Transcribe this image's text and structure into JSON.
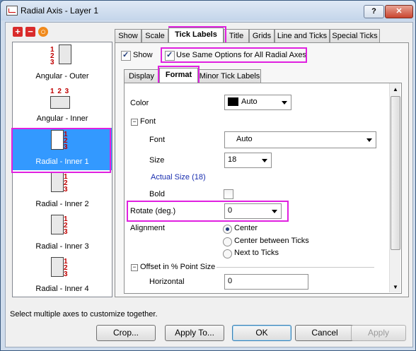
{
  "window": {
    "title": "Radial Axis - Layer 1",
    "help_label": "?",
    "close_label": "✕"
  },
  "toolbar": {
    "add": "+",
    "remove": "−",
    "reset": "○"
  },
  "axes_list": [
    {
      "label": "Angular - Outer",
      "numbers": "1\n2\n3"
    },
    {
      "label": "Angular - Inner",
      "numbers": "1 2 3"
    },
    {
      "label": "Radial - Inner 1",
      "numbers": "1\n2\n3",
      "selected": true
    },
    {
      "label": "Radial - Inner 2",
      "numbers": "1\n2\n3"
    },
    {
      "label": "Radial - Inner 3",
      "numbers": "1\n2\n3"
    },
    {
      "label": "Radial - Inner 4",
      "numbers": "1\n2\n3"
    }
  ],
  "tabs": [
    "Show",
    "Scale",
    "Tick Labels",
    "Title",
    "Grids",
    "Line and Ticks",
    "Special Ticks"
  ],
  "active_tab": "Tick Labels",
  "show_label": "Show",
  "use_same_label": "Use Same Options for All Radial Axes",
  "subtabs": [
    "Display",
    "Format",
    "Minor Tick Labels"
  ],
  "active_subtab": "Format",
  "format": {
    "color_label": "Color",
    "color_value": "Auto",
    "font_group": "Font",
    "font_label": "Font",
    "font_value": "Auto",
    "size_label": "Size",
    "size_value": "18",
    "actual_size": "Actual Size (18)",
    "bold_label": "Bold",
    "rotate_label": "Rotate (deg.)",
    "rotate_value": "0",
    "alignment_label": "Alignment",
    "align_options": [
      "Center",
      "Center between Ticks",
      "Next to Ticks"
    ],
    "align_selected": "Center",
    "offset_group": "Offset in % Point Size",
    "horizontal_label": "Horizontal",
    "horizontal_value": "0"
  },
  "status_text": "Select multiple axes to customize together.",
  "buttons": {
    "crop": "Crop...",
    "apply_to": "Apply To...",
    "ok": "OK",
    "cancel": "Cancel",
    "apply": "Apply"
  },
  "colors": {
    "highlight": "#e020e0",
    "selection": "#3399ff",
    "link_blue": "#1a2fb0",
    "tick_numbers": "#c00000"
  }
}
